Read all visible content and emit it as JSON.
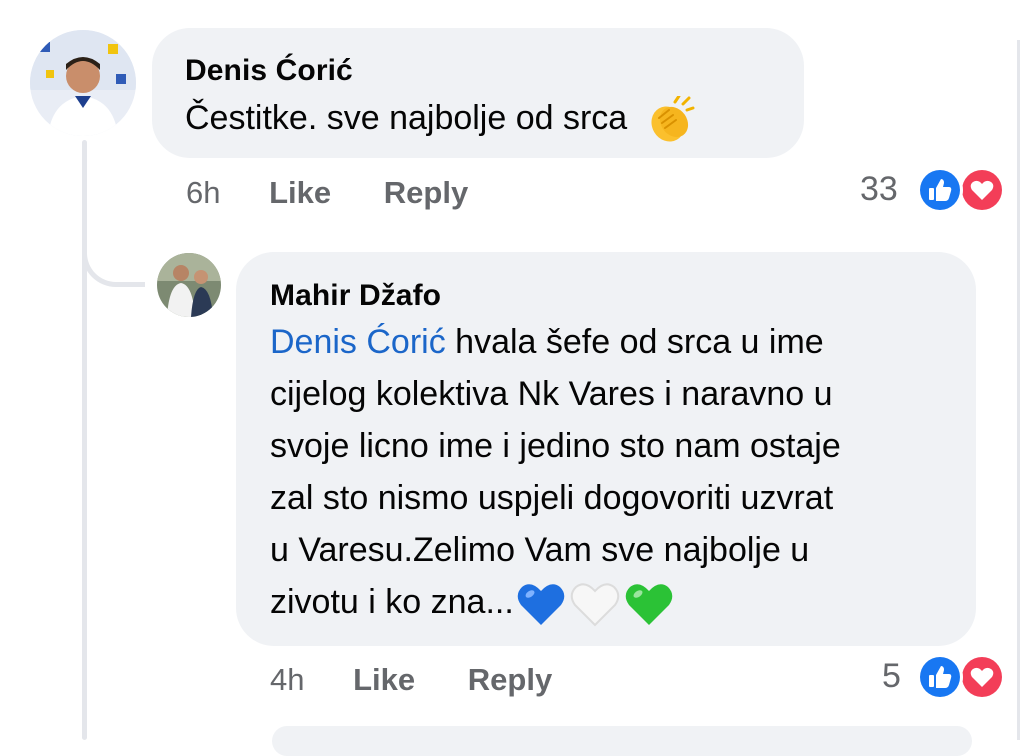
{
  "comments": [
    {
      "author": "Denis Ćorić",
      "text": "Čestitke. sve najbolje od srca",
      "emoji": "clapping-hands-emoji",
      "time": "6h",
      "like_label": "Like",
      "reply_label": "Reply",
      "reaction_count": "33",
      "reactions": [
        "like-icon",
        "love-icon"
      ]
    },
    {
      "author": "Mahir Džafo",
      "mention": "Denis Ćorić",
      "lines": [
        " hvala šefe od srca u ime",
        "cijelog kolektiva Nk Vares i naravno u",
        "svoje licno ime i jedino sto nam ostaje",
        "zal sto nismo uspjeli dogovoriti uzvrat",
        "u Varesu.Zelimo Vam sve najbolje u",
        "zivotu i ko zna..."
      ],
      "emojis": [
        "blue-heart-emoji",
        "white-heart-emoji",
        "green-heart-emoji"
      ],
      "time": "4h",
      "like_label": "Like",
      "reply_label": "Reply",
      "reaction_count": "5",
      "reactions": [
        "like-icon",
        "love-icon"
      ]
    }
  ],
  "colors": {
    "bubble": "#f0f2f5",
    "meta": "#65676b",
    "mention": "#1b66c9",
    "like": "#1877f2",
    "love": "#f33e58"
  }
}
